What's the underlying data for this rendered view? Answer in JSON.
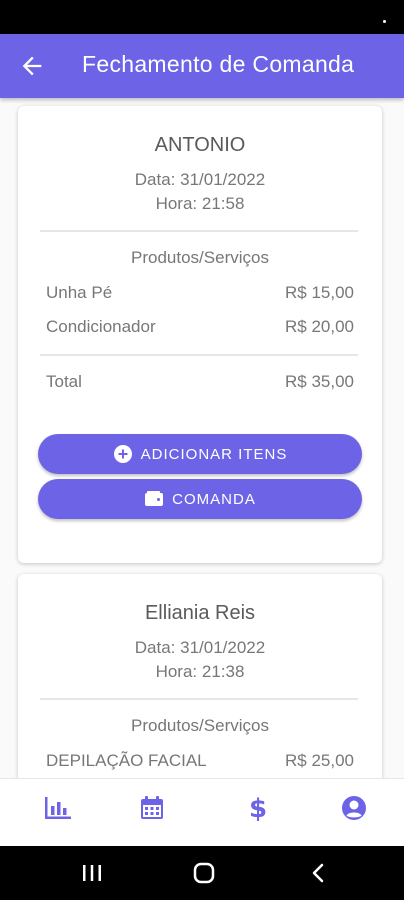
{
  "colors": {
    "accent": "#6c63e6",
    "text": "#777777"
  },
  "header": {
    "title": "Fechamento de Comanda",
    "back_icon": "arrow-left-icon"
  },
  "cards": [
    {
      "client_name": "ANTONIO",
      "date_text": "Data: 31/01/2022",
      "time_text": "Hora: 21:58",
      "section_label": "Produtos/Serviços",
      "items": [
        {
          "name": "Unha Pé",
          "price": "R$ 15,00"
        },
        {
          "name": "Condicionador",
          "price": "R$ 20,00"
        }
      ],
      "total_label": "Total",
      "total_value": "R$ 35,00",
      "add_items_label": "ADICIONAR ITENS",
      "comanda_label": "COMANDA"
    },
    {
      "client_name": "Elliania Reis",
      "date_text": "Data: 31/01/2022",
      "time_text": "Hora: 21:38",
      "section_label": "Produtos/Serviços",
      "items": [
        {
          "name": "DEPILAÇÃO FACIAL",
          "price": "R$ 25,00"
        }
      ]
    }
  ],
  "bottom_nav": [
    {
      "icon": "bar-chart-icon"
    },
    {
      "icon": "calendar-icon"
    },
    {
      "icon": "dollar-icon"
    },
    {
      "icon": "account-icon"
    }
  ]
}
